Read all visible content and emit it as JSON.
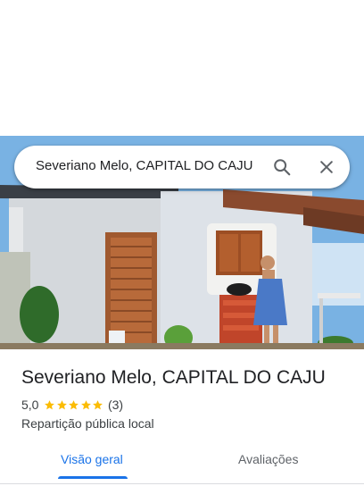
{
  "colors": {
    "accent": "#1a73e8",
    "star": "#fbbc04",
    "text_primary": "#202124",
    "text_secondary": "#3c4043"
  },
  "search": {
    "query": "Severiano Melo, CAPITAL DO CAJU",
    "search_icon": "search-icon",
    "close_icon": "close-icon"
  },
  "place": {
    "title": "Severiano Melo, CAPITAL DO CAJU",
    "rating_value": "5,0",
    "stars": 5,
    "review_count": "(3)",
    "category": "Repartição pública local"
  },
  "tabs": [
    {
      "label": "Visão geral",
      "active": true
    },
    {
      "label": "Avaliações",
      "active": false
    }
  ]
}
